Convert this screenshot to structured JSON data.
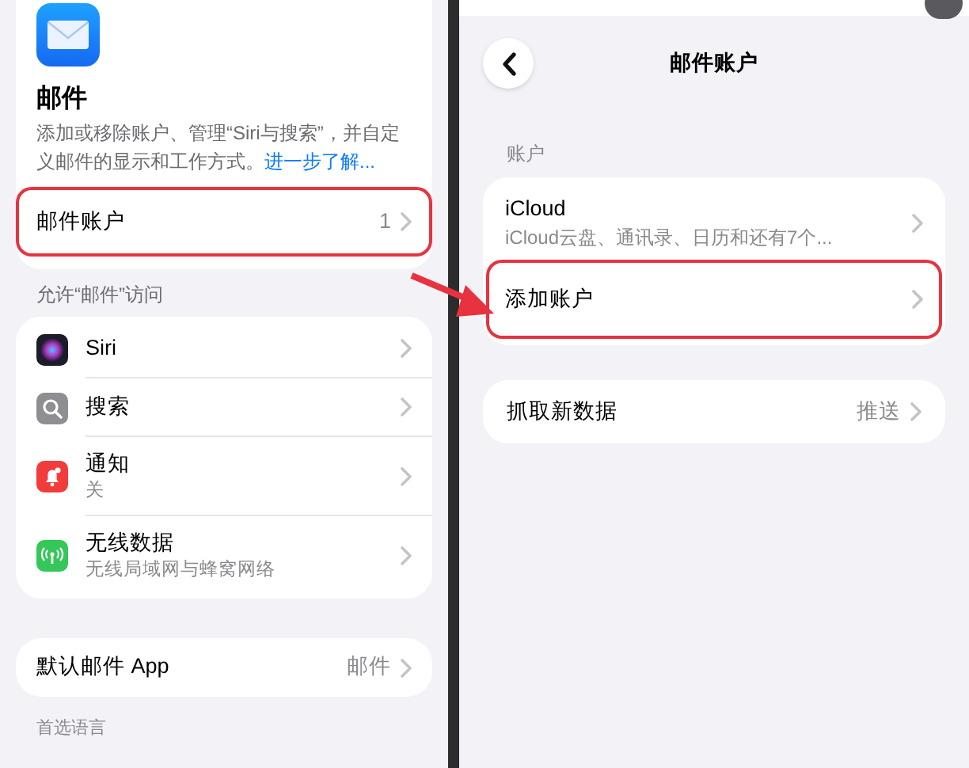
{
  "left": {
    "app": {
      "title": "邮件",
      "description": "添加或移除账户、管理“Siri与搜索”，并自定义邮件的显示和工作方式。",
      "link": "进一步了解..."
    },
    "accounts_row": {
      "label": "邮件账户",
      "value": "1",
      "highlighted": true
    },
    "access_section": {
      "header": "允许“邮件”访问",
      "items": [
        {
          "kind": "siri",
          "label": "Siri"
        },
        {
          "kind": "search",
          "label": "搜索"
        },
        {
          "kind": "notifications",
          "label": "通知",
          "subtitle": "关"
        },
        {
          "kind": "wireless",
          "label": "无线数据",
          "subtitle": "无线局域网与蜂窝网络"
        }
      ]
    },
    "default_row": {
      "label": "默认邮件 App",
      "value": "邮件"
    },
    "next_header": "首选语言"
  },
  "right": {
    "title": "邮件账户",
    "section_header": "账户",
    "accounts": [
      {
        "label": "iCloud",
        "subtitle": "iCloud云盘、通讯录、日历和还有7个...",
        "highlighted": false
      },
      {
        "label": "添加账户",
        "highlighted": true
      }
    ],
    "fetch_row": {
      "label": "抓取新数据",
      "value": "推送"
    }
  }
}
